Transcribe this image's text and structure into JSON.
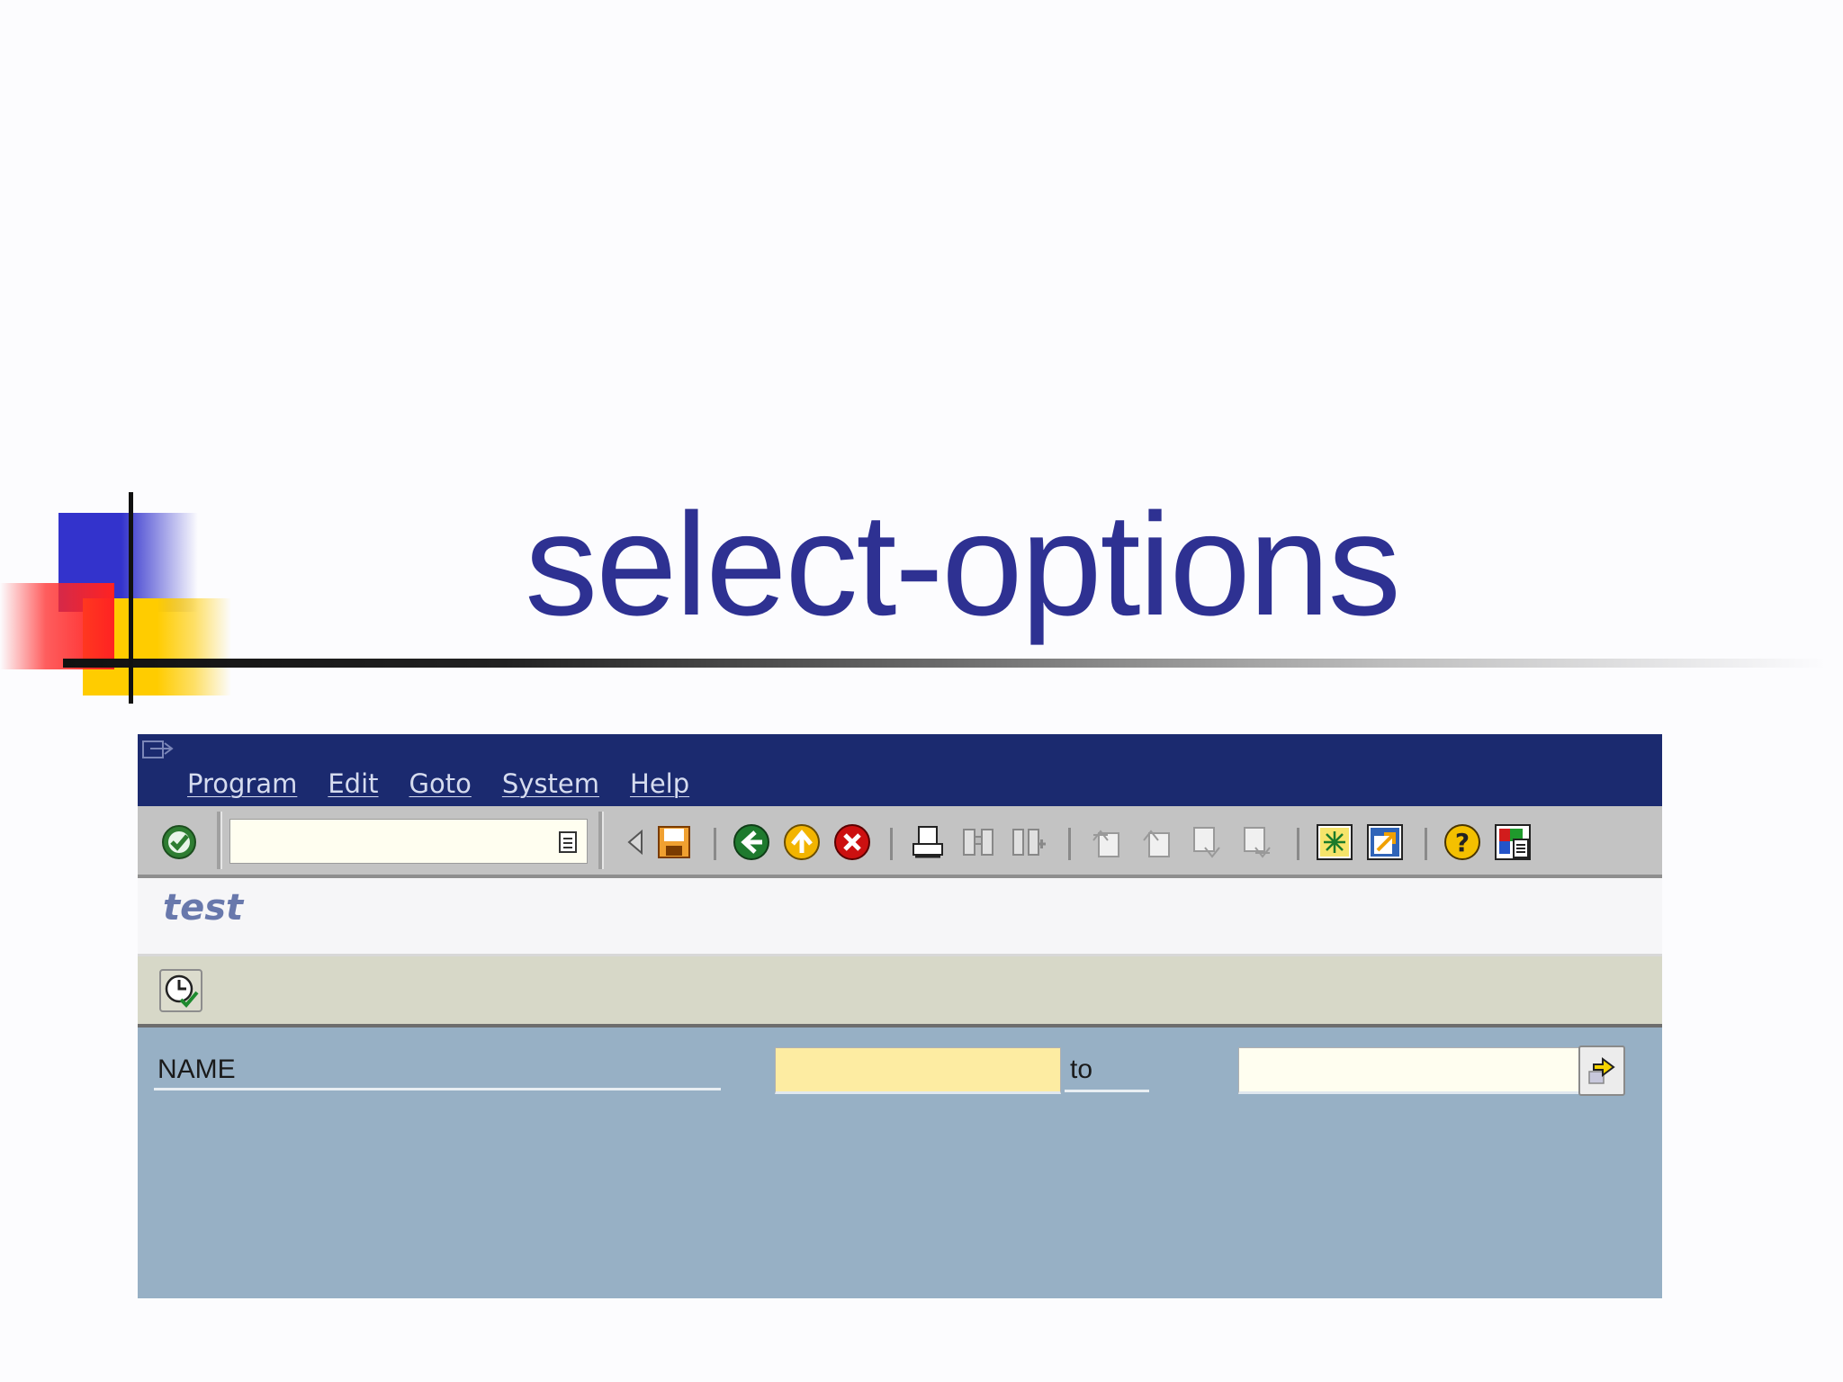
{
  "slide": {
    "title": "select-options"
  },
  "sap": {
    "menu": [
      "Program",
      "Edit",
      "Goto",
      "System",
      "Help"
    ],
    "command_field": {
      "value": "",
      "placeholder": ""
    },
    "screen_title": "test",
    "selection": {
      "field_label": "NAME",
      "to_label": "to",
      "low_value": "",
      "high_value": ""
    },
    "icons": {
      "system": "system-menu-icon",
      "enter": "enter-checkmark-icon",
      "back": "back-arrow-icon",
      "exit": "exit-icon",
      "cancel": "cancel-icon",
      "save": "save-icon",
      "print": "print-icon",
      "find": "find-icon",
      "find_next": "find-next-icon",
      "execute": "execute-icon",
      "multiple_selection": "multiple-selection-arrow-icon"
    },
    "colors": {
      "titlebar": "#1b2a6f",
      "toolbar": "#c3c3c3",
      "selection_area": "#97b0c5",
      "required_input": "#fdeca2",
      "slide_title": "#2e3192"
    }
  }
}
